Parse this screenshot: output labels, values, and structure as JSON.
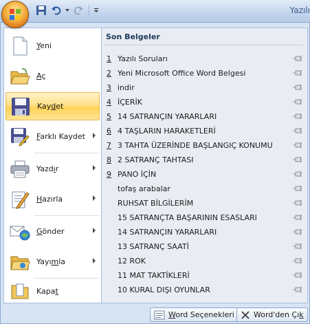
{
  "window": {
    "title_fragment": "Yazılı"
  },
  "colors": {
    "highlight": "#ffd258",
    "menu_background": "#d7e4f4",
    "recent_background": "#e9edf3",
    "text": "#1b1b1b",
    "heading": "#1e395b"
  },
  "quick_access": [
    {
      "icon": "save-icon"
    },
    {
      "icon": "undo-icon"
    },
    {
      "icon": "redo-icon"
    },
    {
      "icon": "customize-qat-icon"
    }
  ],
  "menu": {
    "items": [
      {
        "label_before": "",
        "label_key": "Y",
        "label_after": "eni",
        "icon": "new-document-icon",
        "submenu": false
      },
      {
        "label_before": "",
        "label_key": "A",
        "label_after": "ç",
        "icon": "open-folder-icon",
        "submenu": false
      },
      {
        "label_before": "Kay",
        "label_key": "d",
        "label_after": "et",
        "icon": "save-floppy-icon",
        "submenu": false,
        "active": true
      },
      {
        "label_before": "",
        "label_key": "F",
        "label_after": "arklı Kaydet",
        "icon": "save-as-icon",
        "submenu": true
      },
      {
        "label_before": "Yazd",
        "label_key": "ı",
        "label_after": "r",
        "icon": "printer-icon",
        "submenu": true
      },
      {
        "label_before": "",
        "label_key": "H",
        "label_after": "azırla",
        "icon": "prepare-icon",
        "submenu": true
      },
      {
        "label_before": "",
        "label_key": "G",
        "label_after": "önder",
        "icon": "send-icon",
        "submenu": true
      },
      {
        "label_before": "Yayı",
        "label_key": "m",
        "label_after": "la",
        "icon": "publish-icon",
        "submenu": true
      },
      {
        "label_before": "Kapa",
        "label_key": "t",
        "label_after": "",
        "icon": "close-folder-icon",
        "submenu": false
      }
    ]
  },
  "recent": {
    "title": "Son Belgeler",
    "items": [
      {
        "num": "1",
        "name": "Yazılı Soruları"
      },
      {
        "num": "2",
        "name": "Yeni Microsoft Office Word Belgesi"
      },
      {
        "num": "3",
        "name": "indir"
      },
      {
        "num": "4",
        "name": "İÇERİK"
      },
      {
        "num": "5",
        "name": "14 SATRANÇIN YARARLARI"
      },
      {
        "num": "6",
        "name": "4 TAŞLARIN HARAKETLERİ"
      },
      {
        "num": "7",
        "name": "3 TAHTA ÜZERİNDE BAŞLANGIÇ KONUMU"
      },
      {
        "num": "8",
        "name": "2 SATRANÇ TAHTASI"
      },
      {
        "num": "9",
        "name": "PANO İÇİN"
      },
      {
        "num": "",
        "name": "tofaş arabalar"
      },
      {
        "num": "",
        "name": "RUHSAT BİLGİLERİM"
      },
      {
        "num": "",
        "name": "15 SATRANÇTA BAŞARININ ESASLARI"
      },
      {
        "num": "",
        "name": "14 SATRANÇIN YARARLARI"
      },
      {
        "num": "",
        "name": "13 SATRANÇ SAATİ"
      },
      {
        "num": "",
        "name": "12 ROK"
      },
      {
        "num": "",
        "name": "11 MAT TAKTİKLERİ"
      },
      {
        "num": "",
        "name": "10 KURAL DIŞI OYUNLAR"
      }
    ]
  },
  "footer": {
    "options_key": "W",
    "options_rest": "ord Seçenekleri",
    "exit_before": "Word'den Çı",
    "exit_key": "k"
  }
}
